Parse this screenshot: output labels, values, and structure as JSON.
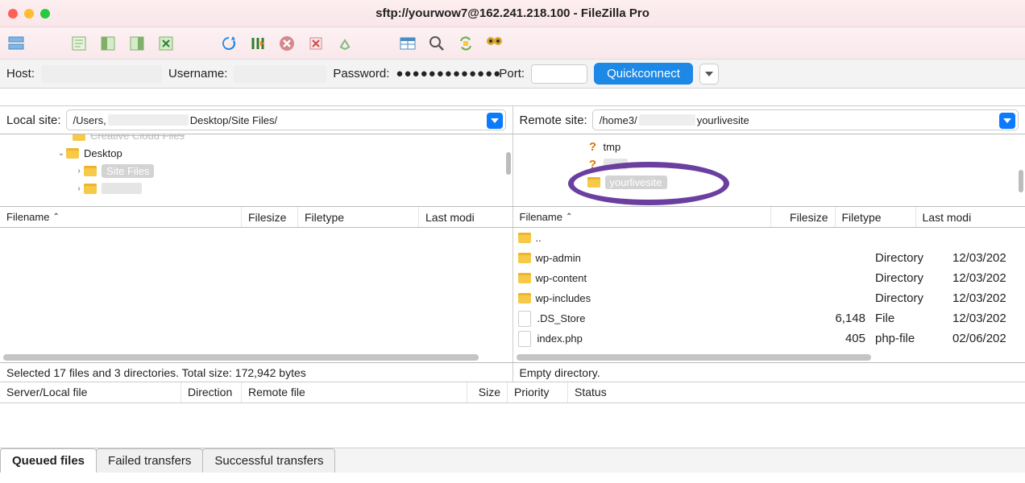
{
  "window": {
    "title": "sftp://yourwow7@162.241.218.100 - FileZilla Pro"
  },
  "toolbar_icons": [
    "site-manager-icon",
    "toggle-log-icon",
    "toggle-local-tree-icon",
    "toggle-remote-tree-icon",
    "toggle-queue-icon",
    "refresh-icon",
    "process-queue-icon",
    "cancel-icon",
    "disconnect-icon",
    "reconnect-icon",
    "compare-icon",
    "search-icon",
    "sync-browse-icon",
    "filters-icon"
  ],
  "connbar": {
    "host_label": "Host:",
    "username_label": "Username:",
    "password_label": "Password:",
    "password_value": "●●●●●●●●●●●●●",
    "port_label": "Port:",
    "port_value": "",
    "quickconnect_label": "Quickconnect"
  },
  "local": {
    "site_label": "Local site:",
    "path_prefix": "/Users,",
    "path_suffix": "Desktop/Site Files/",
    "tree": {
      "cut_top": "Creative Cloud Files",
      "desktop": "Desktop",
      "selected": "Site Files"
    },
    "headers": {
      "filename": "Filename",
      "filesize": "Filesize",
      "filetype": "Filetype",
      "lastmod": "Last modi"
    },
    "status": "Selected 17 files and 3 directories. Total size: 172,942 bytes"
  },
  "remote": {
    "site_label": "Remote site:",
    "path_prefix": "/home3/",
    "path_suffix": "yourlivesite",
    "tree": {
      "tmp": "tmp",
      "selected": "yourlivesite"
    },
    "headers": {
      "filename": "Filename",
      "filesize": "Filesize",
      "filetype": "Filetype",
      "lastmod": "Last modi"
    },
    "files": [
      {
        "name": "..",
        "size": "",
        "type": "",
        "mod": ""
      },
      {
        "name": "wp-admin",
        "size": "",
        "type": "Directory",
        "mod": "12/03/202"
      },
      {
        "name": "wp-content",
        "size": "",
        "type": "Directory",
        "mod": "12/03/202"
      },
      {
        "name": "wp-includes",
        "size": "",
        "type": "Directory",
        "mod": "12/03/202"
      },
      {
        "name": ".DS_Store",
        "size": "6,148",
        "type": "File",
        "mod": "12/03/202"
      },
      {
        "name": "index.php",
        "size": "405",
        "type": "php-file",
        "mod": "02/06/202"
      }
    ],
    "status": "Empty directory."
  },
  "queue_headers": {
    "server": "Server/Local file",
    "direction": "Direction",
    "remote": "Remote file",
    "size": "Size",
    "priority": "Priority",
    "status": "Status"
  },
  "tabs": {
    "queued": "Queued files",
    "failed": "Failed transfers",
    "successful": "Successful transfers"
  }
}
